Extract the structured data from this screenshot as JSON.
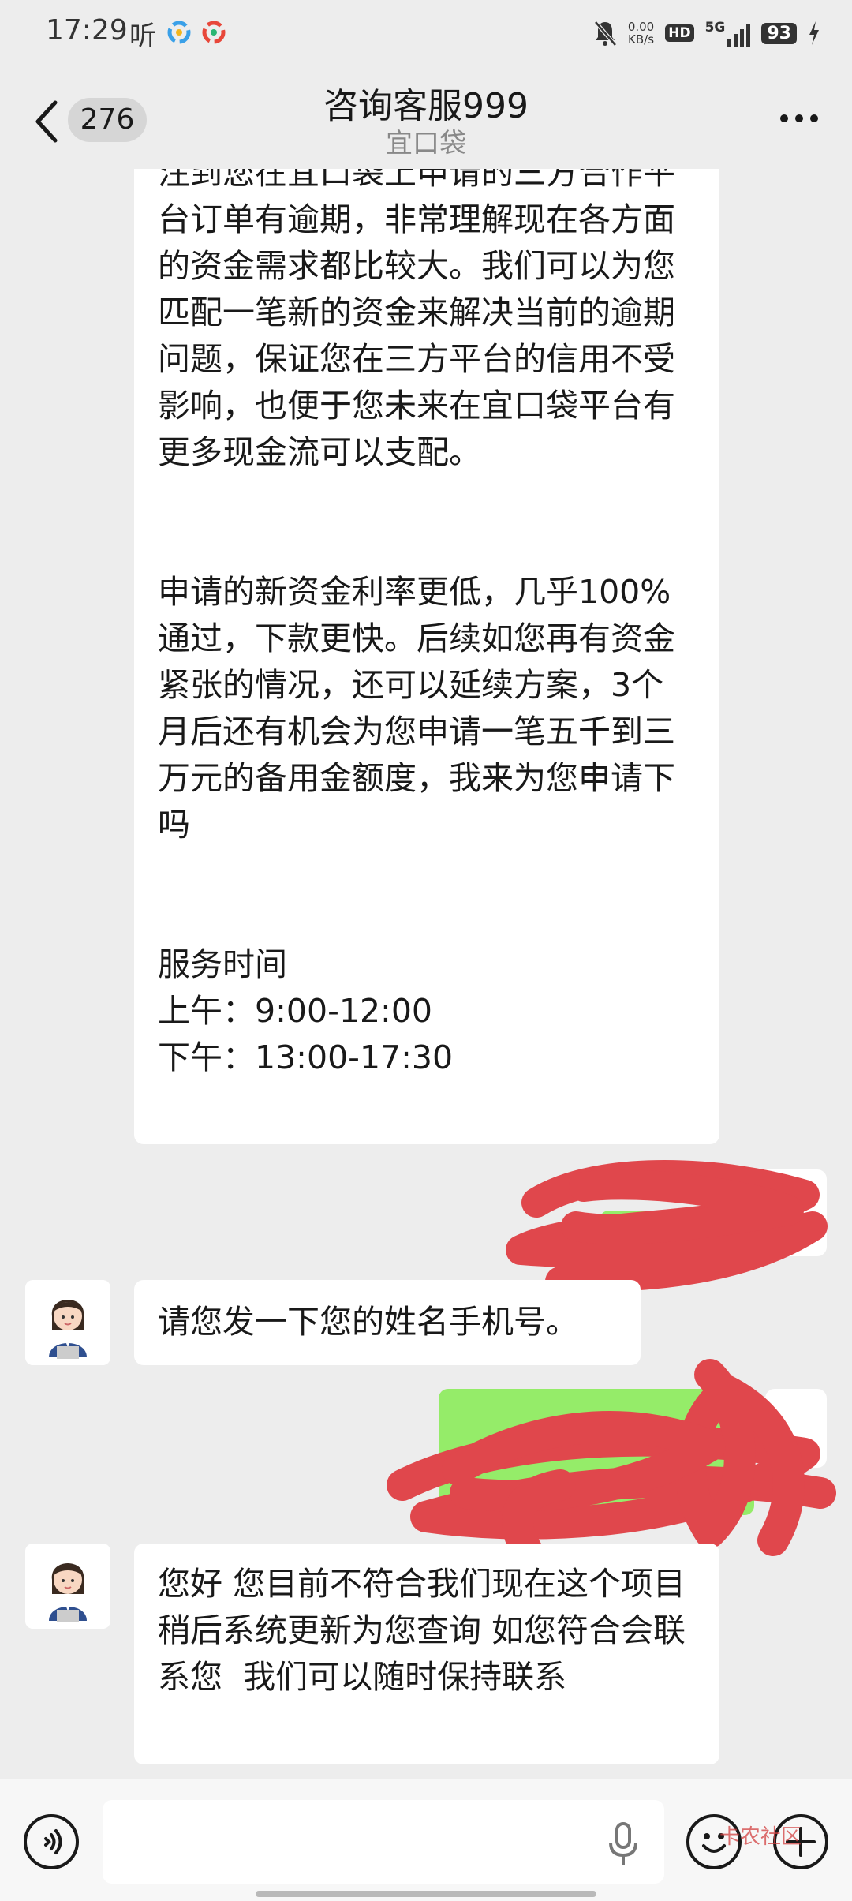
{
  "status_bar": {
    "time": "17:29",
    "listen": "听",
    "speed_value": "0.00",
    "speed_unit": "KB/s",
    "hd": "HD",
    "network": "5G",
    "battery": "93"
  },
  "header": {
    "unread_count": "276",
    "title": "咨询客服999",
    "subtitle": "宜口袋"
  },
  "messages": [
    {
      "side": "left",
      "paragraphs": [
        "注到您在宜口袋上申请的三方合作平台订单有逾期，非常理解现在各方面的资金需求都比较大。我们可以为您匹配一笔新的资金来解决当前的逾期问题，保证您在三方平台的信用不受影响，也便于您未来在宜口袋平台有更多现金流可以支配。",
        "",
        "申请的新资金利率更低，几乎100%通过，下款更快。后续如您再有资金紧张的情况，还可以延续方案，3个月后还有机会为您申请一笔五千到三万元的备用金额度，我来为您申请下吗",
        "",
        "服务时间",
        "上午：9:00-12:00",
        "下午：13:00-17:30"
      ]
    },
    {
      "side": "left",
      "text": "请您发一下您的姓名手机号。"
    },
    {
      "side": "left",
      "text": "您好 您目前不符合我们现在这个项目  稍后系统更新为您查询 如您符合会联系您  我们可以随时保持联系"
    }
  ],
  "watermark": "卡农社区",
  "colors": {
    "background": "#ededed",
    "bubble_left": "#ffffff",
    "bubble_right": "#95ec69",
    "scribble": "#e0474c"
  },
  "icons": [
    "back-chevron-icon",
    "more-icon",
    "voice-icon",
    "mic-icon",
    "emoji-icon",
    "plus-icon",
    "mute-bell-icon"
  ]
}
